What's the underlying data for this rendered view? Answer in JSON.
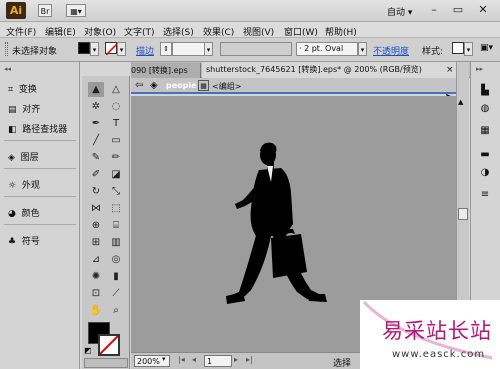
{
  "app": {
    "logo": "Ai",
    "workspace": "自动 ▾"
  },
  "window_buttons": {
    "minimize": "–",
    "restore": "▭",
    "close": "✕"
  },
  "menus": [
    "文件(F)",
    "编辑(E)",
    "对象(O)",
    "文字(T)",
    "选择(S)",
    "效果(C)",
    "视图(V)",
    "窗口(W)",
    "帮助(H)"
  ],
  "control": {
    "selection": "未选择对象",
    "stroke_label": "描边",
    "stroke_profile": "2 pt. Oval",
    "opacity_label": "不透明度",
    "style_label": "样式:"
  },
  "left_panels": [
    "变换",
    "对齐",
    "路径查找器",
    "图层",
    "外观",
    "颜色",
    "符号"
  ],
  "tabs": {
    "inactive": "090 [转换].eps",
    "active": "shutterstock_7645621 [转换].eps* @ 200% (RGB/预览)"
  },
  "breadcrumb": {
    "layer": "people",
    "group": "<编组>"
  },
  "status": {
    "zoom": "200%",
    "page": "1",
    "tool": "选择"
  },
  "watermark": {
    "title": "易采站长站",
    "url": "www.easck.com"
  },
  "colors": {
    "canvas": "#9c9c9c",
    "silhouette": "#000000",
    "watermark": "#b0187a"
  }
}
